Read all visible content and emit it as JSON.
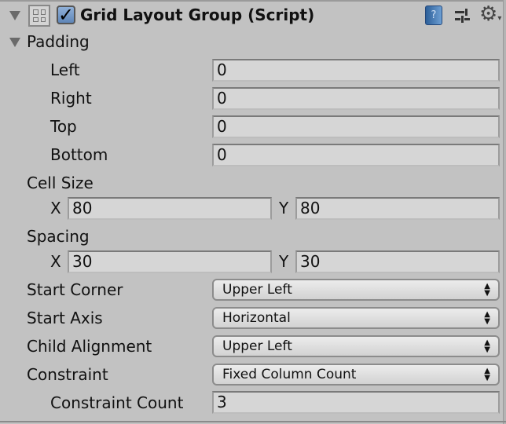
{
  "component": {
    "title": "Grid Layout Group (Script)",
    "enabled": true,
    "help_icon": "help-book-icon",
    "preset_icon": "preset-sliders-icon",
    "settings_icon": "gear-icon"
  },
  "padding": {
    "label": "Padding",
    "fields": [
      {
        "label": "Left",
        "value": "0"
      },
      {
        "label": "Right",
        "value": "0"
      },
      {
        "label": "Top",
        "value": "0"
      },
      {
        "label": "Bottom",
        "value": "0"
      }
    ]
  },
  "cell_size": {
    "label": "Cell Size",
    "x_label": "X",
    "x": "80",
    "y_label": "Y",
    "y": "80"
  },
  "spacing": {
    "label": "Spacing",
    "x_label": "X",
    "x": "30",
    "y_label": "Y",
    "y": "30"
  },
  "dropdowns": [
    {
      "label": "Start Corner",
      "value": "Upper Left"
    },
    {
      "label": "Start Axis",
      "value": "Horizontal"
    },
    {
      "label": "Child Alignment",
      "value": "Upper Left"
    },
    {
      "label": "Constraint",
      "value": "Fixed Column Count"
    }
  ],
  "constraint_count": {
    "label": "Constraint Count",
    "value": "3"
  }
}
